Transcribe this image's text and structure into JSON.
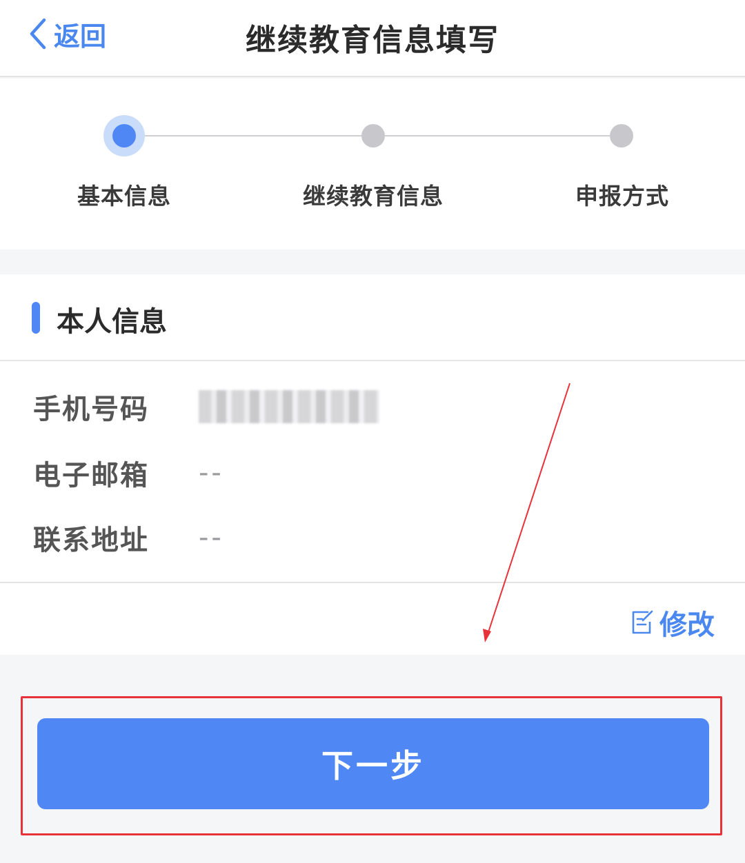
{
  "header": {
    "back_label": "返回",
    "title": "继续教育信息填写"
  },
  "stepper": {
    "steps": [
      {
        "label": "基本信息",
        "active": true
      },
      {
        "label": "继续教育信息",
        "active": false
      },
      {
        "label": "申报方式",
        "active": false
      }
    ]
  },
  "section": {
    "title": "本人信息",
    "rows": [
      {
        "label": "手机号码",
        "value": "",
        "masked": true
      },
      {
        "label": "电子邮箱",
        "value": "--"
      },
      {
        "label": "联系地址",
        "value": "--"
      }
    ],
    "edit_label": "修改"
  },
  "footer": {
    "next_label": "下一步"
  },
  "colors": {
    "accent": "#4f87f5",
    "highlight": "#e8323a"
  }
}
